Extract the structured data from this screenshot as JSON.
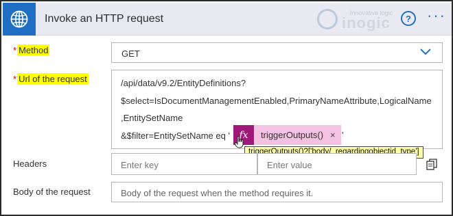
{
  "header": {
    "title": "Invoke an HTTP request",
    "icon": "globe-icon",
    "logo": {
      "tagline": "Innovative logic",
      "wordmark": "inogic"
    },
    "help_label": "?",
    "more_label": "···"
  },
  "fields": {
    "method": {
      "required_mark": "*",
      "label": "Method",
      "value": "GET"
    },
    "url": {
      "required_mark": "*",
      "label": "Url of the request",
      "lines": [
        "/api/data/v9.2/EntityDefinitions?",
        "$select=IsDocumentManagementEnabled,PrimaryNameAttribute,LogicalName",
        ",EntitySetName",
        "&$filter=EntitySetName eq '"
      ],
      "token": {
        "fx_label": "fx",
        "label": "triggerOutputs()",
        "close": "×"
      },
      "trailing": "'",
      "tooltip": "triggerOutputs()?['body/_regardingobjectid_type']"
    },
    "headers": {
      "label": "Headers",
      "key_placeholder": "Enter key",
      "value_placeholder": "Enter value"
    },
    "body": {
      "label": "Body of the request",
      "placeholder": "Body of the request when the method requires it."
    }
  },
  "colors": {
    "accent": "#1f6fc5",
    "token_fx": "#a0187a",
    "token_body": "#f2c2e0",
    "highlight": "#ffff00",
    "tooltip_bg": "#ffffa8"
  }
}
